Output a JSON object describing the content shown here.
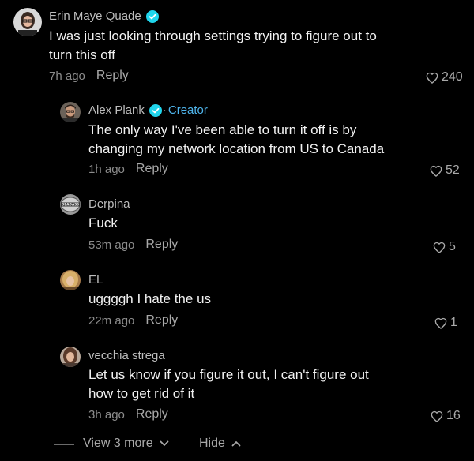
{
  "comments": [
    {
      "author": "Erin Maye Quade",
      "verified": true,
      "creator": "",
      "lines": [
        "I was just looking through settings trying to figure out to",
        "turn this off"
      ],
      "time": "7h ago",
      "reply_label": "Reply",
      "likes": "240"
    },
    {
      "author": "Alex Plank",
      "verified": true,
      "creator": "Creator",
      "lines": [
        "The only way I've been able to turn it off is by",
        "changing my network location from US to Canada"
      ],
      "time": "1h ago",
      "reply_label": "Reply",
      "likes": "52"
    },
    {
      "author": "Derpina",
      "verified": false,
      "creator": "",
      "lines": [
        "Fuck"
      ],
      "time": "53m ago",
      "reply_label": "Reply",
      "likes": "5",
      "avatar_text": "DEADASS"
    },
    {
      "author": "EL",
      "verified": false,
      "creator": "",
      "lines": [
        "uggggh I hate the us"
      ],
      "time": "22m ago",
      "reply_label": "Reply",
      "likes": "1"
    },
    {
      "author": "vecchia strega",
      "verified": false,
      "creator": "",
      "lines": [
        "Let us know if you figure it out, I can't figure out",
        "how to get rid of it"
      ],
      "time": "3h ago",
      "reply_label": "Reply",
      "likes": "16"
    }
  ],
  "footer": {
    "view_more_label": "View 3 more",
    "hide_label": "Hide"
  },
  "colors": {
    "background": "#000000",
    "verified": "#20d5ec",
    "creator": "#4fb5ec",
    "text": "#f2f2f2",
    "meta": "#8c8c8c"
  },
  "icons": {
    "verified": "verified-badge-icon",
    "like": "heart-outline-icon",
    "view_more": "chevron-down-icon",
    "hide": "chevron-up-icon"
  }
}
